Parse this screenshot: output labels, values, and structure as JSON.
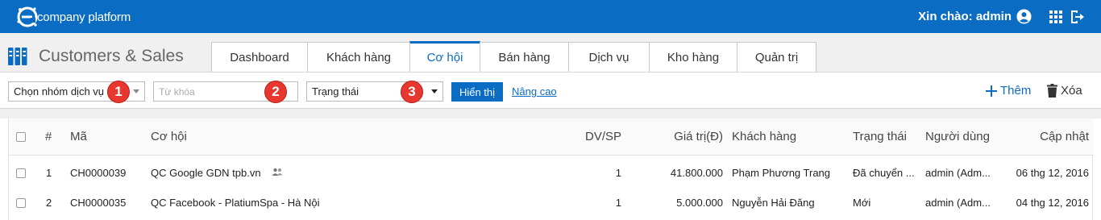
{
  "brand": {
    "logo_text": "company platform",
    "colors": {
      "primary": "#0b6cc4",
      "badge": "#e8372e"
    }
  },
  "header": {
    "greeting": "Xin chào: admin",
    "icons": [
      "user-circle-icon",
      "apps-grid-icon",
      "logout-icon"
    ]
  },
  "app": {
    "title": "Customers & Sales"
  },
  "tabs": [
    {
      "label": "Dashboard"
    },
    {
      "label": "Khách hàng"
    },
    {
      "label": "Cơ hội",
      "active": true
    },
    {
      "label": "Bán hàng"
    },
    {
      "label": "Dịch vụ"
    },
    {
      "label": "Kho hàng"
    },
    {
      "label": "Quản trị"
    }
  ],
  "filters": {
    "group_select": "Chọn nhóm dịch vụ",
    "keyword_placeholder": "Từ khóa",
    "status_select": "Trạng thái",
    "show_button": "Hiển thị",
    "advanced_link": "Nâng cao",
    "badges": [
      "1",
      "2",
      "3"
    ]
  },
  "actions": {
    "add_label": "Thêm",
    "delete_label": "Xóa"
  },
  "table": {
    "columns": [
      "#",
      "Mã",
      "Cơ hội",
      "DV/SP",
      "Giá trị(Đ)",
      "Khách hàng",
      "Trạng thái",
      "Người dùng",
      "Cập nhật"
    ],
    "rows": [
      {
        "num": "1",
        "code": "CH0000039",
        "opportunity": "QC Google GDN tpb.vn",
        "shared_icon": "group-icon",
        "qty": "1",
        "value": "41.800.000",
        "customer": "Phạm Phương Trang",
        "status": "Đã chuyển ...",
        "user": "admin (Adm...",
        "updated": "06 thg 12, 2016"
      },
      {
        "num": "2",
        "code": "CH0000035",
        "opportunity": "QC Facebook - PlatiumSpa - Hà Nội",
        "qty": "1",
        "value": "5.000.000",
        "customer": "Nguyễn Hải Đăng",
        "status": "Mới",
        "user": "admin (Adm...",
        "updated": "04 thg 12, 2016"
      }
    ]
  }
}
